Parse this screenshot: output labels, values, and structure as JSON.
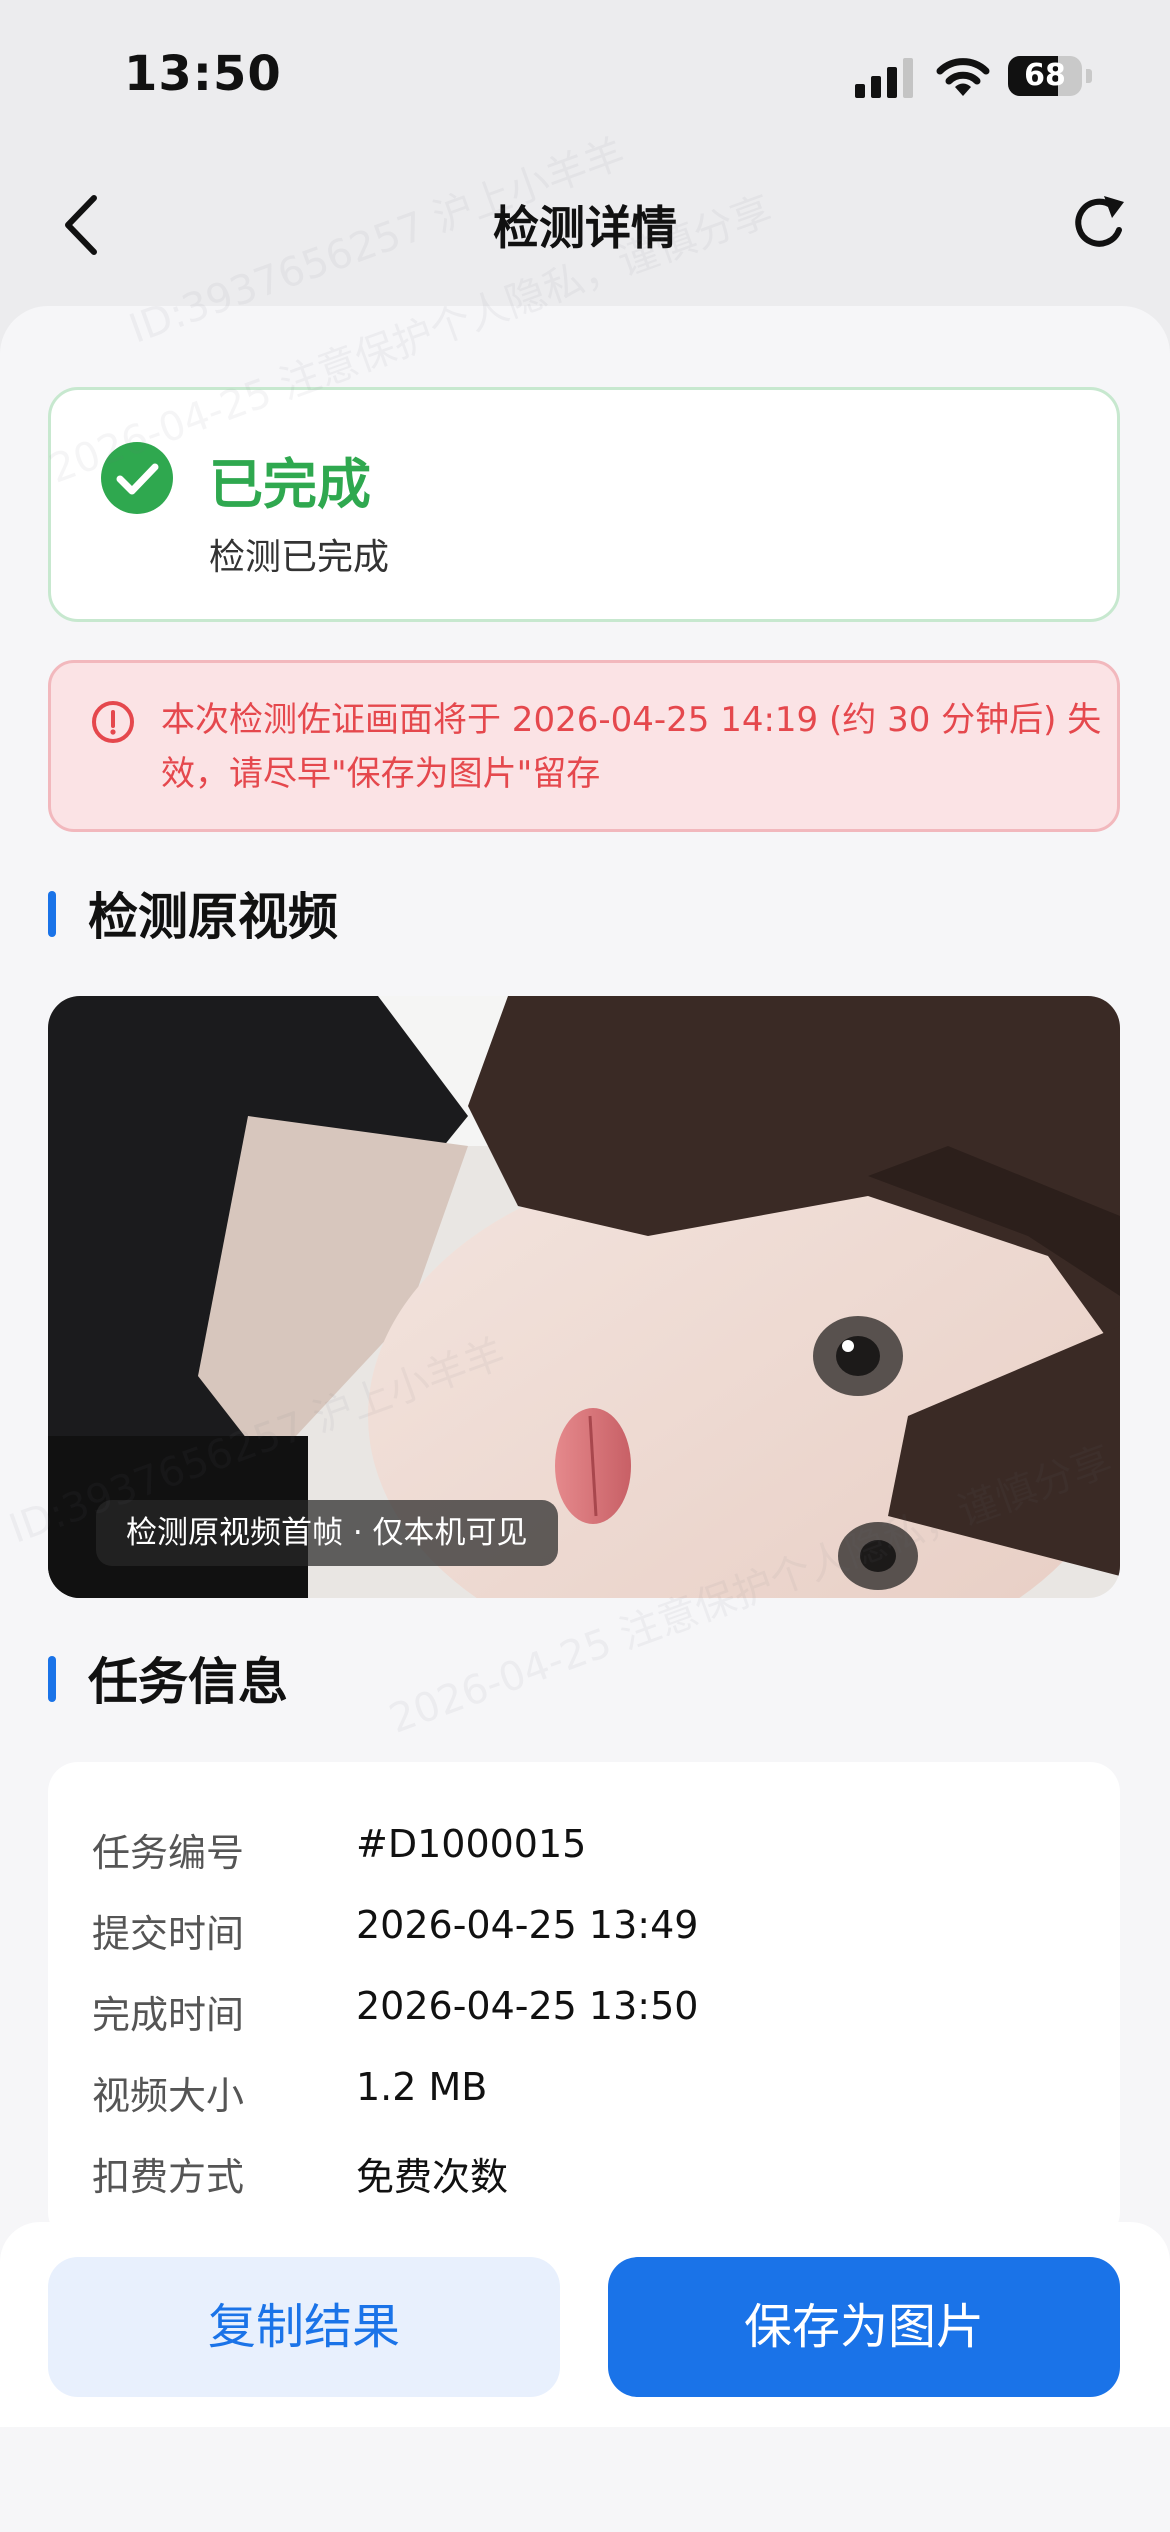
{
  "status_bar": {
    "time": "13:50",
    "battery": "68",
    "battery_level": 0.68
  },
  "nav": {
    "title": "检测详情"
  },
  "status_card": {
    "title": "已完成",
    "subtitle": "检测已完成"
  },
  "alert": {
    "text": "本次检测佐证画面将于 2026-04-25 14:19 (约 30 分钟后) 失效，请尽早\"保存为图片\"留存"
  },
  "video_section": {
    "title": "检测原视频",
    "caption": "检测原视频首帧 · 仅本机可见"
  },
  "task_section": {
    "title": "任务信息",
    "rows": [
      {
        "label": "任务编号",
        "value": "#D1000015"
      },
      {
        "label": "提交时间",
        "value": "2026-04-25 13:49"
      },
      {
        "label": "完成时间",
        "value": "2026-04-25 13:50"
      },
      {
        "label": "视频大小",
        "value": "1.2 MB"
      },
      {
        "label": "扣费方式",
        "value": "免费次数"
      }
    ]
  },
  "actions": {
    "copy_label": "复制结果",
    "save_label": "保存为图片"
  },
  "watermark": {
    "lines": [
      "ID:3937656257 沪上小羊羊",
      "2026-04-25 注意保护个人隐私，谨慎分享"
    ]
  },
  "colors": {
    "accent": "#1a73e8",
    "success": "#2fa84f",
    "danger": "#e5484d"
  }
}
